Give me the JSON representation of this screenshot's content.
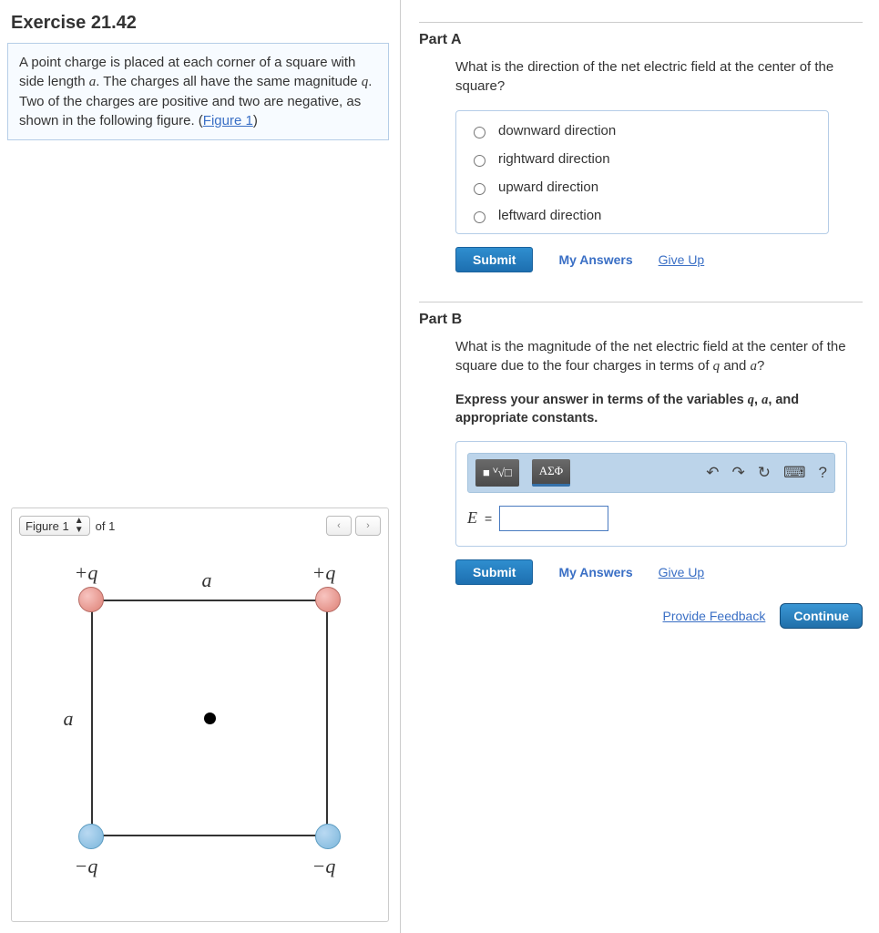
{
  "exercise_title": "Exercise 21.42",
  "problem": {
    "text_1": "A point charge is placed at each corner of a square with side length ",
    "var_a": "a",
    "text_2": ". The charges all have the same magnitude ",
    "var_q": "q",
    "text_3": ". Two of the charges are positive and two are negative, as shown in the following figure. (",
    "figure_link": "Figure 1",
    "text_4": ")"
  },
  "figure": {
    "selector_label": "Figure 1",
    "of_text": "of 1",
    "prev": "‹",
    "next": "›",
    "labels": {
      "tl": "+q",
      "tr": "+q",
      "bl": "−q",
      "br": "−q",
      "top_side": "a",
      "left_side": "a"
    }
  },
  "partA": {
    "title": "Part A",
    "question": "What is the direction of the net electric field at the center of the square?",
    "options": [
      "downward direction",
      "rightward direction",
      "upward direction",
      "leftward direction"
    ]
  },
  "partB": {
    "title": "Part B",
    "question_1": "What is the magnitude of the net electric field at the center of the square due to the four charges in terms of ",
    "q": "q",
    "and1": " and ",
    "a": "a",
    "qmark": "?",
    "instr_1": "Express your answer in terms of the variables ",
    "instr_q": "q",
    "comma": ", ",
    "instr_a": "a",
    "instr_2": ", and appropriate constants.",
    "eq_label": "E",
    "eq_sign": " = ",
    "toolbar": {
      "chip1": "■ ⱽ√□",
      "chip2": "ΑΣΦ",
      "undo": "↶",
      "redo": "↷",
      "reset": "↻",
      "keyboard": "⌨",
      "help": "?"
    }
  },
  "actions": {
    "submit": "Submit",
    "my_answers": "My Answers",
    "give_up": "Give Up",
    "provide_feedback": "Provide Feedback",
    "continue": "Continue"
  }
}
